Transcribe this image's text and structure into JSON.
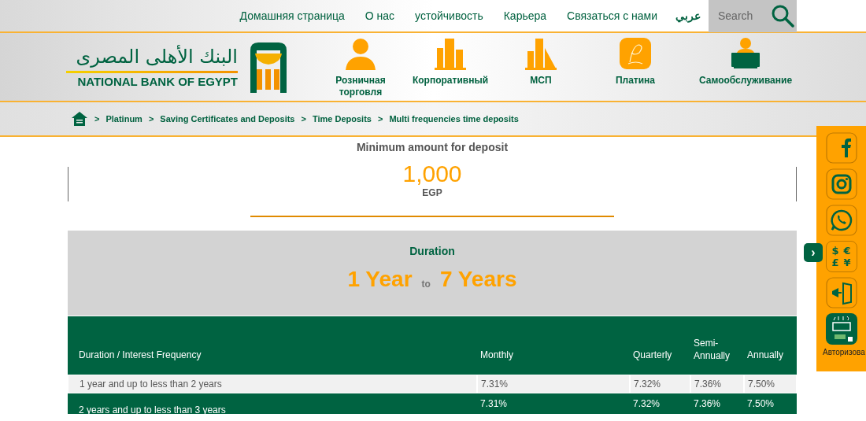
{
  "top_nav": {
    "links": [
      "Домашняя страница",
      "О нас",
      "устойчивость",
      "Карьера",
      "Связаться с нами"
    ],
    "language": "عربي",
    "search": {
      "placeholder": "Search"
    }
  },
  "logo": {
    "arabic": "البنك الأهلى المصرى",
    "english": "NATIONAL BANK OF EGYPT"
  },
  "categories": [
    {
      "kind": "person",
      "label": "Розничная торговля"
    },
    {
      "kind": "buildings",
      "label": "Корпоративный"
    },
    {
      "kind": "tower",
      "label": "МСП"
    },
    {
      "kind": "platinum",
      "label": "Платина"
    },
    {
      "kind": "laptop",
      "label": "Самообслуживание"
    }
  ],
  "breadcrumb": [
    {
      "separator": ">",
      "label": "Platinum"
    },
    {
      "separator": ">",
      "label": "Saving Certificates and Deposits"
    },
    {
      "separator": ">",
      "label": "Time Deposits"
    },
    {
      "separator": ">",
      "label": "Multi frequencies time deposits"
    }
  ],
  "minimum": {
    "title": "Minimum amount for deposit",
    "amount": "1,000",
    "currency": "EGP"
  },
  "duration": {
    "title": "Duration",
    "from": "1 Year",
    "joiner": "to",
    "to": "7 Years"
  },
  "table": {
    "columns": [
      "Duration / Interest Frequency",
      "Monthly",
      "Quarterly",
      "Semi-Annually",
      "Annually"
    ],
    "rows": [
      [
        "1 year and up to less than 2 years",
        "7.31%",
        "7.32%",
        "7.36%",
        "7.50%"
      ],
      [
        "2 years and up to less than 3 years",
        "7.31%",
        "7.32%",
        "7.36%",
        "7.50%"
      ]
    ]
  },
  "side_panel": {
    "toggle": "›",
    "items": [
      {
        "kind": "facebook"
      },
      {
        "kind": "instagram"
      },
      {
        "kind": "whatsapp"
      },
      {
        "kind": "currency",
        "symbols": [
          "$",
          "€",
          "£",
          "¥"
        ]
      },
      {
        "kind": "exit"
      }
    ],
    "nbe_label": "Авторизова"
  }
}
